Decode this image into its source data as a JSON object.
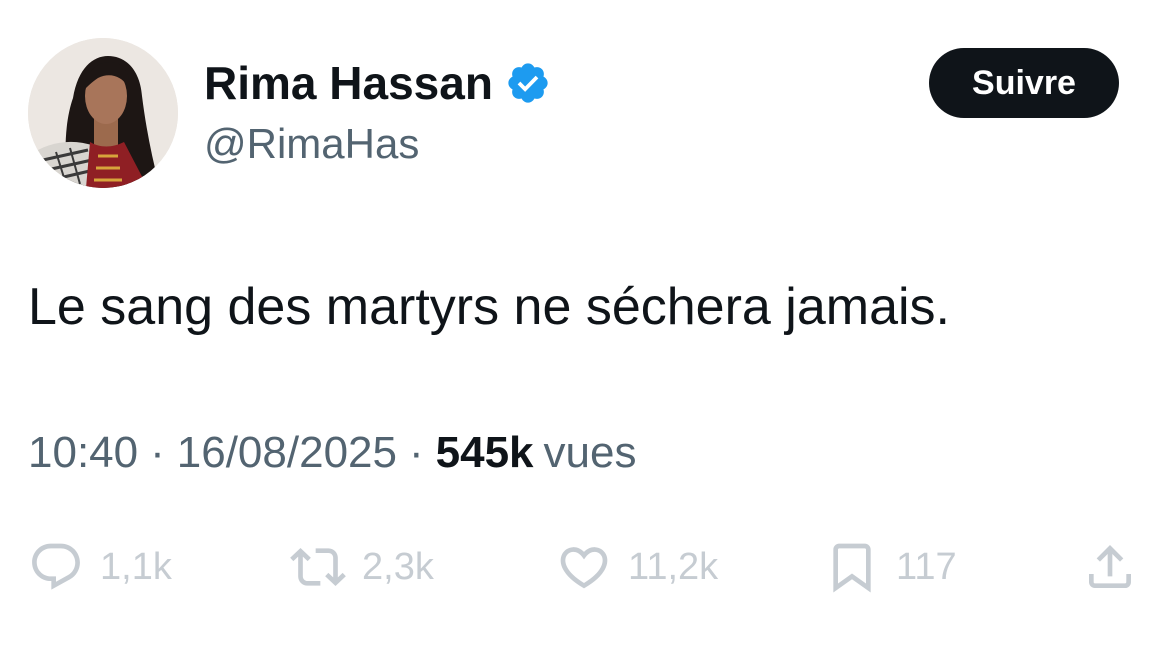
{
  "author": {
    "display_name": "Rima Hassan",
    "handle": "@RimaHas",
    "verified": true
  },
  "follow_button": {
    "label": "Suivre"
  },
  "tweet": {
    "text": "Le sang des martyrs ne séchera jamais."
  },
  "meta": {
    "time": "10:40",
    "separator": "·",
    "date": "16/08/2025",
    "views_count": "545k",
    "views_label": "vues"
  },
  "actions": {
    "replies": "1,1k",
    "reposts": "2,3k",
    "likes": "11,2k",
    "bookmarks": "117"
  },
  "icons": {
    "verified": "verified-badge-icon",
    "reply": "reply-icon",
    "repost": "repost-icon",
    "like": "heart-icon",
    "bookmark": "bookmark-icon",
    "share": "share-icon"
  },
  "colors": {
    "text_primary": "#0f1419",
    "text_secondary": "#536471",
    "action_muted": "#c6ccd2",
    "verified_blue": "#1d9bf0",
    "button_bg": "#0f1419",
    "button_text": "#ffffff"
  }
}
